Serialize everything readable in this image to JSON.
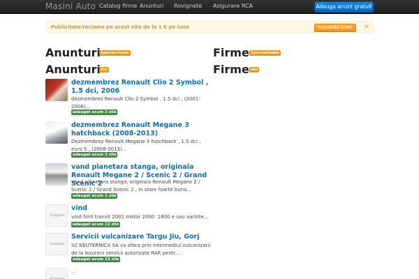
{
  "navbar": {
    "brand": "Masini Auto",
    "items": [
      "Catalog firme",
      "Anunturi",
      "Rovignete",
      "Asigurare RCA"
    ],
    "cta": "Adauga anunt gratuit"
  },
  "alert": {
    "text": "Publicitate/reclame pe acest site de la 1 € pe luna",
    "button": "Comanda acum",
    "close": "×"
  },
  "sections": {
    "ads_sponsored": {
      "title": "Anunturi",
      "badge": "Sponsorizate"
    },
    "ads_new": {
      "title": "Anunturi",
      "badge": "Noi"
    },
    "firms_sponsored": {
      "title": "Firme",
      "badge": "Sponsorizate"
    },
    "firms_new": {
      "title": "Firme",
      "badge": "Noi"
    }
  },
  "listings": [
    {
      "title": "dezmembrez Renault Clio 2 Symbol , 1.5 dci, 2006",
      "desc": "dezmembrez Renault Clio 2 Symbol , 1.5 dci , (2001-2006)...",
      "added": "adaugat acum 2 zile",
      "thumb": "car-photo"
    },
    {
      "title": "dezmembrez Renault Megane 3 hatchback (2008-2013)",
      "desc": "Dezmembrez Renault Megane 3 hatchback , 1.5 dci , euro 5 , (2008-2013)...",
      "added": "adaugat acum 2 zile",
      "thumb": "car-photo"
    },
    {
      "title": "vand planetara stanga, originala Renault Megane 2 / Scenic 2 / Grand Scenic 2",
      "desc": "vand planetara stanga, originala Renault Megane 2 / Scenic 2 / Grand Scenic 2 , in stare foarte buna...",
      "added": "adaugat acum 2 zile",
      "thumb": "part-photo"
    },
    {
      "title": "vind",
      "desc": "vind ford transit 2001 motor 2000 .1800 e sau varinte...",
      "added": "adaugat acum 12 zile",
      "thumb": "imagine"
    },
    {
      "title": "Servicii vulcanizare Targu Jiu, Gorj",
      "desc": "SC KEUTERNICA SA va ofera prin intermediul vulcanizarii de la lezureni servicii autorizate RAR pentr...",
      "added": "adaugat acum 13 zile",
      "thumb": "imagine"
    },
    {
      "title": "",
      "desc": "...",
      "added": "",
      "thumb": "imagine"
    }
  ]
}
